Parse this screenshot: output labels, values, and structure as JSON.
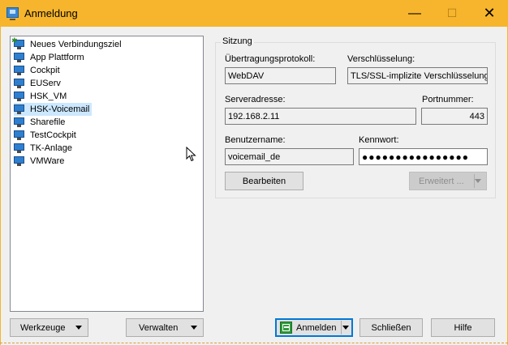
{
  "window": {
    "title": "Anmeldung",
    "minimize_glyph": "—",
    "maximize_glyph": "☐",
    "close_glyph": "✕",
    "icon": "app-monitor-icon"
  },
  "sites": {
    "items": [
      {
        "label": "Neues Verbindungsziel",
        "icon": "new-site-icon",
        "selected": false
      },
      {
        "label": "App Plattform",
        "icon": "monitor-icon",
        "selected": false
      },
      {
        "label": "Cockpit",
        "icon": "monitor-icon",
        "selected": false
      },
      {
        "label": "EUServ",
        "icon": "monitor-icon",
        "selected": false
      },
      {
        "label": "HSK_VM",
        "icon": "monitor-icon",
        "selected": false
      },
      {
        "label": "HSK-Voicemail",
        "icon": "monitor-icon",
        "selected": true
      },
      {
        "label": "Sharefile",
        "icon": "monitor-icon",
        "selected": false
      },
      {
        "label": "TestCockpit",
        "icon": "monitor-icon",
        "selected": false
      },
      {
        "label": "TK-Anlage",
        "icon": "monitor-icon",
        "selected": false
      },
      {
        "label": "VMWare",
        "icon": "monitor-icon",
        "selected": false
      }
    ]
  },
  "session": {
    "group_title": "Sitzung",
    "protocol_label": "Übertragungsprotokoll:",
    "protocol_value": "WebDAV",
    "encryption_label": "Verschlüsselung:",
    "encryption_value": "TLS/SSL-implizite Verschlüsselung",
    "server_label": "Serveradresse:",
    "server_value": "192.168.2.11",
    "port_label": "Portnummer:",
    "port_value": "443",
    "user_label": "Benutzername:",
    "user_value": "voicemail_de",
    "password_label": "Kennwort:",
    "password_value": "●●●●●●●●●●●●●●●●",
    "edit_button": "Bearbeiten",
    "advanced_button": "Erweitert ..."
  },
  "footer": {
    "tools_button": "Werkzeuge",
    "manage_button": "Verwalten",
    "login_button": "Anmelden",
    "close_button": "Schließen",
    "help_button": "Hilfe"
  },
  "colors": {
    "titlebar": "#f6b52c",
    "selection": "#cce8ff",
    "primary_border": "#0078d7"
  }
}
